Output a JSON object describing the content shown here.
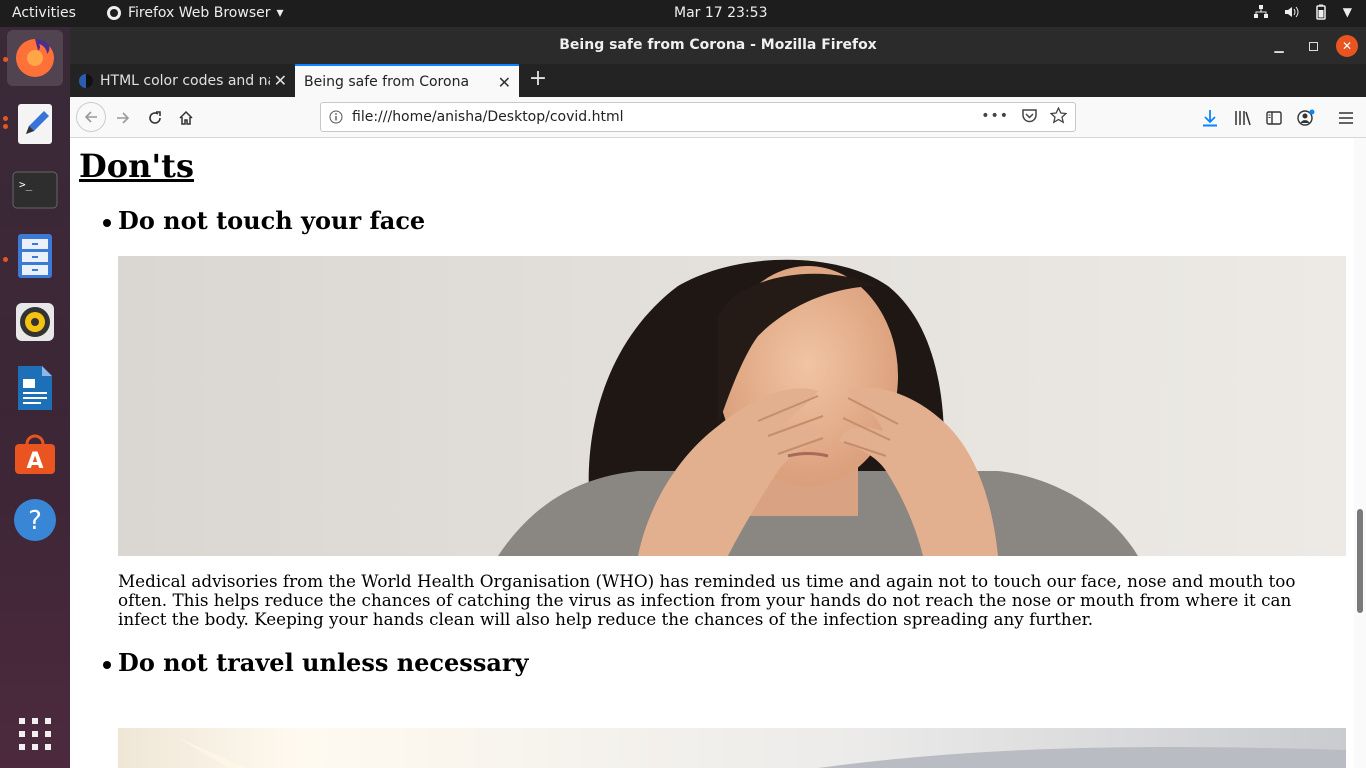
{
  "topbar": {
    "activities": "Activities",
    "app_menu": "Firefox Web Browser",
    "clock": "Mar 17  23:53",
    "icons": [
      "network-icon",
      "volume-icon",
      "battery-icon",
      "system-menu-chevron-icon"
    ]
  },
  "dock": {
    "apps": [
      "firefox-icon",
      "text-editor-icon",
      "terminal-icon",
      "files-icon",
      "rhythmbox-icon",
      "writer-icon",
      "software-center-icon",
      "help-icon",
      "show-apps-icon"
    ]
  },
  "window": {
    "title": "Being safe from Corona - Mozilla Firefox"
  },
  "tabs": [
    {
      "label": "HTML color codes and na",
      "active": false
    },
    {
      "label": "Being safe from Corona",
      "active": true
    }
  ],
  "navbar": {
    "url": "file:///home/anisha/Desktop/covid.html",
    "page_actions": "•••"
  },
  "page": {
    "heading": "Don'ts",
    "items": [
      {
        "title": "Do not touch your face",
        "text": "Medical advisories from the World Health Organisation (WHO) has reminded us time and again not to touch our face, nose and mouth too often. This helps reduce the chances of catching the virus as infection from your hands do not reach the nose or mouth from where it can infect the body. Keeping your hands clean will also help reduce the chances of the infection spreading any further."
      },
      {
        "title": "Do not travel unless necessary"
      }
    ]
  },
  "colors": {
    "accent": "#e95420",
    "tab_highlight": "#0a84ff",
    "download_blue": "#0a84ff"
  }
}
